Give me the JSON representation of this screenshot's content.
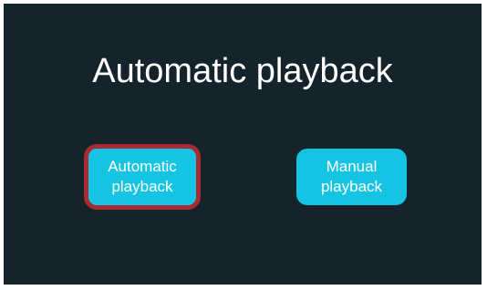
{
  "screen": {
    "title": "Automatic playback",
    "buttons": {
      "automatic": {
        "label": "Automatic\nplayback",
        "selected": true
      },
      "manual": {
        "label": "Manual\nplayback",
        "selected": false
      }
    }
  },
  "colors": {
    "background": "#15242b",
    "button": "#15c3e3",
    "selection_border": "#a82a33",
    "text": "#ffffff"
  }
}
